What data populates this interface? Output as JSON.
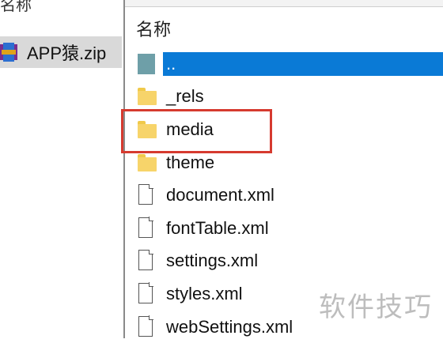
{
  "left_pane": {
    "header": "名称",
    "items": [
      {
        "name": "APP猿.zip",
        "icon": "winrar-archive-icon"
      }
    ]
  },
  "archive_window": {
    "column_header": "名称",
    "items": [
      {
        "name": "..",
        "icon": "parent-folder-icon",
        "selected": true
      },
      {
        "name": "_rels",
        "icon": "folder-icon"
      },
      {
        "name": "media",
        "icon": "folder-icon",
        "highlighted": true
      },
      {
        "name": "theme",
        "icon": "folder-icon"
      },
      {
        "name": "document.xml",
        "icon": "file-icon"
      },
      {
        "name": "fontTable.xml",
        "icon": "file-icon"
      },
      {
        "name": "settings.xml",
        "icon": "file-icon"
      },
      {
        "name": "styles.xml",
        "icon": "file-icon"
      },
      {
        "name": "webSettings.xml",
        "icon": "file-icon"
      }
    ]
  },
  "watermark": "软件技巧",
  "colors": {
    "selection": "#0a7ad6",
    "highlight_border": "#d63a2f",
    "folder": "#f7d46a"
  }
}
